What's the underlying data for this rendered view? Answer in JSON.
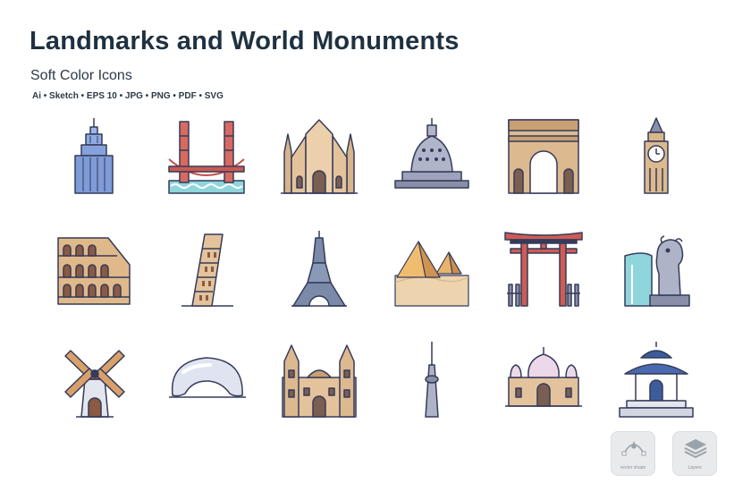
{
  "header": {
    "title": "Landmarks and World Monuments",
    "subtitle": "Soft Color Icons",
    "formats": "Ai • Sketch • EPS 10 • JPG • PNG • PDF • SVG"
  },
  "palette": {
    "outline": "#353b5a",
    "sand": "#e3c096",
    "sand_dark": "#c9a074",
    "red": "#cf5b55",
    "blue": "#7fa0dc",
    "water": "#7fd0d8",
    "grey": "#aeb3c8",
    "steel": "#7a8aa8"
  },
  "icons": [
    {
      "name": "empire-state-building-icon"
    },
    {
      "name": "golden-gate-bridge-icon"
    },
    {
      "name": "milan-cathedral-icon"
    },
    {
      "name": "borobudur-temple-icon"
    },
    {
      "name": "arc-de-triomphe-icon"
    },
    {
      "name": "big-ben-icon"
    },
    {
      "name": "colosseum-icon"
    },
    {
      "name": "leaning-tower-of-pisa-icon"
    },
    {
      "name": "eiffel-tower-icon"
    },
    {
      "name": "pyramids-of-giza-icon"
    },
    {
      "name": "torii-gate-icon"
    },
    {
      "name": "merlion-icon"
    },
    {
      "name": "windmill-icon"
    },
    {
      "name": "cloud-gate-bean-icon"
    },
    {
      "name": "gothic-cathedral-icon"
    },
    {
      "name": "cn-tower-icon"
    },
    {
      "name": "taj-mahal-icon"
    },
    {
      "name": "chiang-kai-shek-memorial-icon"
    }
  ],
  "badges": [
    {
      "name": "vector-shape-badge",
      "icon": "pen-tool-icon",
      "label": "vector shape"
    },
    {
      "name": "layers-badge",
      "icon": "layers-icon",
      "label": "Layers"
    }
  ]
}
